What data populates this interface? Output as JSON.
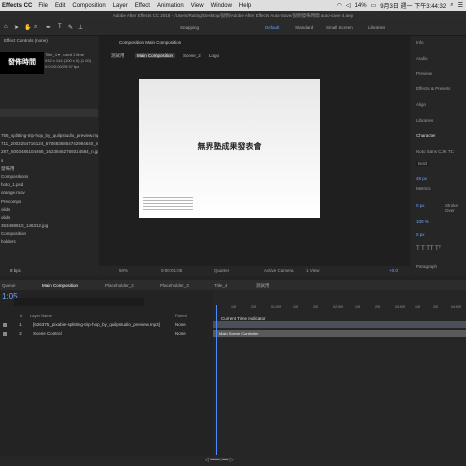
{
  "menubar": {
    "app": "Effects CC",
    "items": [
      "File",
      "Edit",
      "Composition",
      "Layer",
      "Effect",
      "Animation",
      "View",
      "Window",
      "Help"
    ],
    "battery": "14%",
    "datetime": "9月3日 週一 下午3:44:32"
  },
  "title": "Adobe After Effects CC 2018 - /Users/Rating/Desktop/說明/Adobe After Effects Auto-Save/說明發佈時間 auto-save 4.aep",
  "toolbar": {
    "snapping": "Snapping",
    "workspaces": [
      "Default",
      "Standard",
      "Small Screen",
      "Libraries"
    ]
  },
  "project": {
    "tab": "Effect Controls (none)",
    "info": [
      "Title_4 ▾ , used 1 time",
      "932 x 144 (100 x 0) (1.00)",
      "0:0:02:00/29.97 fps"
    ],
    "thumb_text": "發佈時間",
    "items": [
      "755_splitting-trip-hop_by_quilpstudio_preview.mp3",
      "711_2003254716124_6706836854742984640_n.jpg",
      "287_5003485104468_16238462759314584_n.jpg",
      "s",
      "發佈用",
      "Compositions",
      "hoto_1.psd",
      "orange.mov",
      "Precomps",
      "olids",
      "olids",
      "353498810_146312.jpg",
      "Composition",
      "holders"
    ],
    "footer": "8 bpc"
  },
  "viewer": {
    "tab": "Composition Main Composition",
    "breadcrumbs": [
      "測試用",
      "Main Composition",
      "Scene_2",
      "Logo"
    ],
    "caption": "無界塾成果發表會",
    "zoom": "50%",
    "timecode": "0:00:01:05",
    "resolution": "Quarter",
    "camera": "Active Camera",
    "views": "1 View",
    "exposure": "+0.0"
  },
  "right": {
    "items": [
      "Info",
      "Audio",
      "Preview",
      "Effects & Presets",
      "Align",
      "Libraries",
      "Character",
      "Paragraph"
    ],
    "font": "Noto Sans CJK TC",
    "style": "Bold",
    "size": "48 px",
    "tracking": "Metrics",
    "stroke": "0 px",
    "stroke_type": "Stroke Over",
    "scale": "100 %",
    "baseline": "0 px"
  },
  "timeline": {
    "tabs": [
      "Queue",
      "Main Composition",
      "Placeholder_2",
      "Placeholder_3",
      "Title_4",
      "測試用"
    ],
    "timecode": "1:05",
    "columns": [
      "#",
      "Layer Name",
      "Parent"
    ],
    "layers": [
      {
        "num": "1",
        "name": "[626375_pixabie-splitting-trip-hop_by_quilpstudio_preview.mp3]",
        "parent": "None"
      },
      {
        "num": "2",
        "name": "Scene Control",
        "parent": "None"
      }
    ],
    "indicator": "Current Time Indicator",
    "bar_label": "Main Scene Controller",
    "ruler": [
      "10f",
      "20f",
      "01:00f",
      "10f",
      "20f",
      "02:00f",
      "10f",
      "20f",
      "03:00f",
      "10f",
      "20f",
      "04:00f"
    ]
  }
}
